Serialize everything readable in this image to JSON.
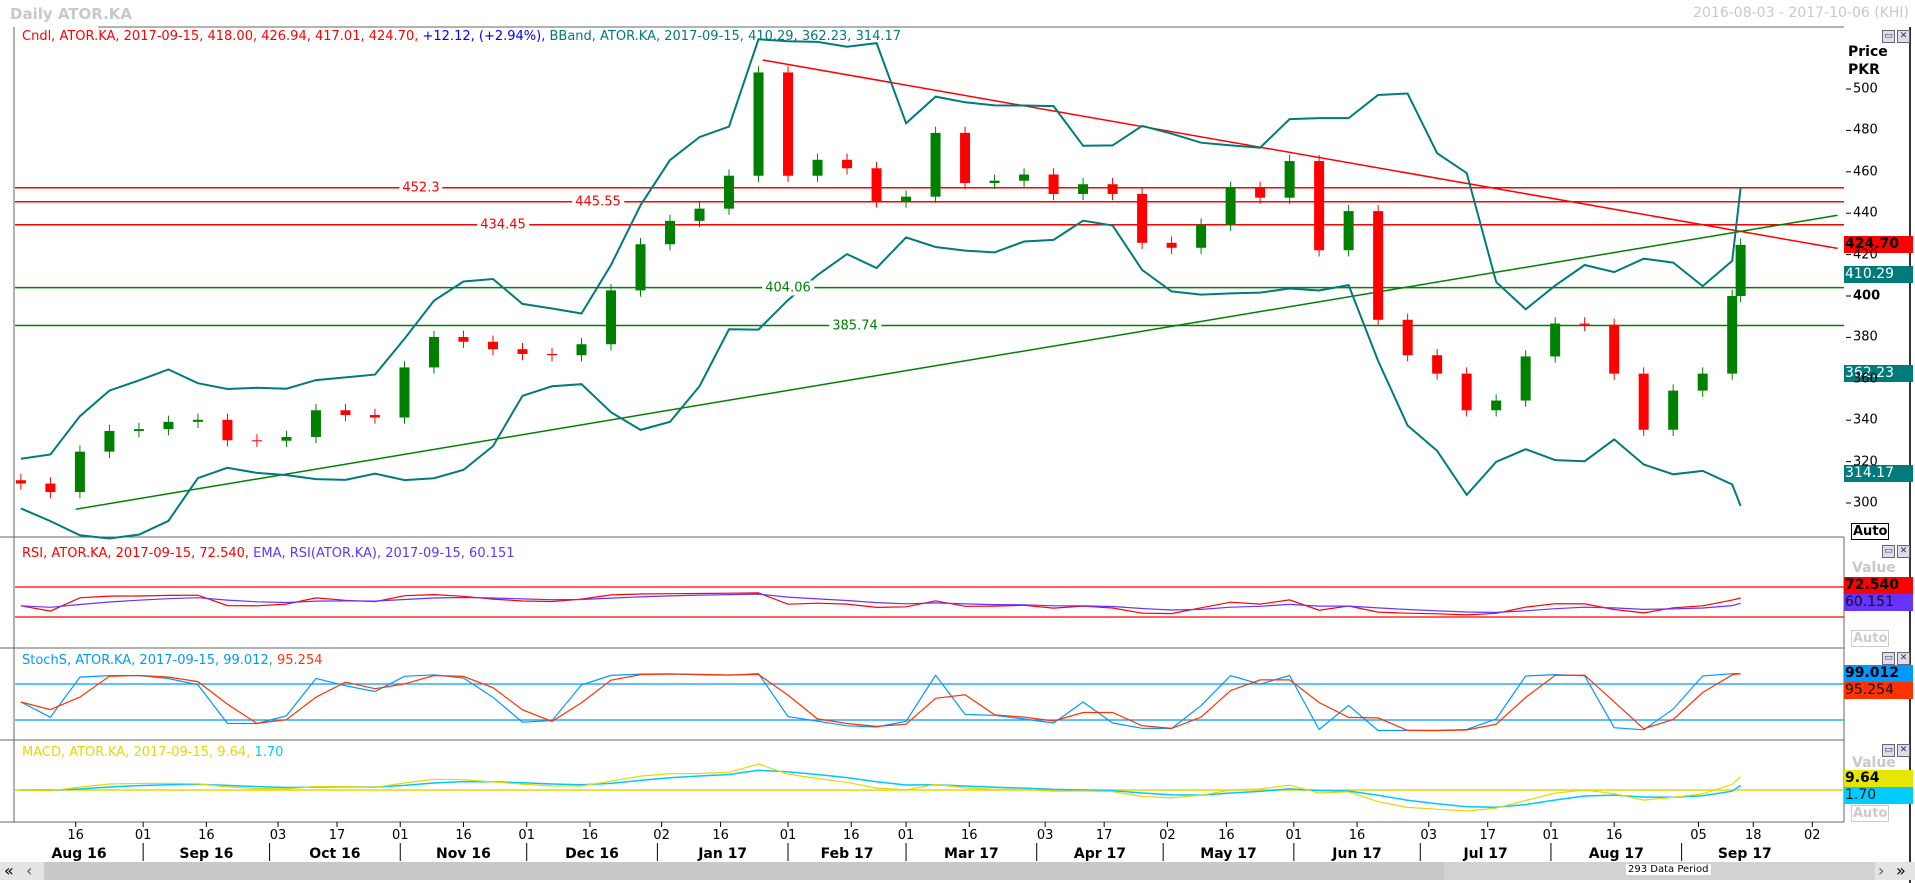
{
  "window": {
    "title": "Daily ATOR.KA",
    "date_range": "2016-08-03 - 2017-10-06 (KHI)"
  },
  "price_panel": {
    "legend_candle": "Cndl, ATOR.KA, 2017-09-15, 418.00, 426.94, 417.01, 424.70,",
    "legend_change": "+12.12, (+2.94%),",
    "legend_bband": "BBand, ATOR.KA, 2017-09-15, 410.29, 362.23, 314.17",
    "axis_title": "Price",
    "axis_unit": "PKR",
    "auto_label": "Auto",
    "last_close": "424.70",
    "bb_upper": "410.29",
    "bb_mid": "362.23",
    "bb_lower": "314.17"
  },
  "rsi_panel": {
    "legend_rsi": "RSI, ATOR.KA, 2017-09-15, 72.540,",
    "legend_ema": "EMA, RSI(ATOR.KA), 2017-09-15, 60.151",
    "value_label": "Value",
    "rsi_value": "72.540",
    "ema_value": "60.151",
    "auto_label": "Auto"
  },
  "stoch_panel": {
    "legend_k": "StochS, ATOR.KA, 2017-09-15, 99.012,",
    "legend_d": "95.254",
    "k_value": "99.012",
    "d_value": "95.254"
  },
  "macd_panel": {
    "legend_macd": "MACD, ATOR.KA, 2017-09-15, 9.64,",
    "legend_signal": "1.70",
    "value_label": "Value",
    "macd_value": "9.64",
    "signal_value": "1.70",
    "auto_label": "Auto"
  },
  "scrollbar": {
    "first": "«",
    "prev": "‹",
    "next": "›",
    "last": "»",
    "period_label": "293 Data Period"
  },
  "colors": {
    "up": "#008000",
    "down": "#ff0000",
    "bband": "#007b7b",
    "rsi": "#ff0000",
    "rsi_ema": "#6633ff",
    "stoch_k": "#0099ff",
    "stoch_d": "#ff3300",
    "macd": "#e6d800",
    "macd_signal": "#00c8ff",
    "resistance": "#ff0000",
    "support": "#008000"
  },
  "chart_data": {
    "type": "candlestick",
    "symbol": "ATOR.KA",
    "ylabel": "Price PKR",
    "ylim": [
      296,
      522
    ],
    "y_ticks": [
      500,
      480,
      460,
      440,
      420,
      400,
      380,
      360,
      340,
      320,
      300
    ],
    "dates": [
      "2016-08-03",
      "2016-08-10",
      "2016-08-17",
      "2016-08-24",
      "2016-08-31",
      "2016-09-07",
      "2016-09-14",
      "2016-09-21",
      "2016-09-28",
      "2016-10-05",
      "2016-10-12",
      "2016-10-19",
      "2016-10-26",
      "2016-11-02",
      "2016-11-09",
      "2016-11-16",
      "2016-11-23",
      "2016-11-30",
      "2016-12-07",
      "2016-12-14",
      "2016-12-21",
      "2016-12-28",
      "2017-01-04",
      "2017-01-11",
      "2017-01-18",
      "2017-01-25",
      "2017-02-01",
      "2017-02-08",
      "2017-02-15",
      "2017-02-22",
      "2017-03-01",
      "2017-03-08",
      "2017-03-15",
      "2017-03-22",
      "2017-03-29",
      "2017-04-05",
      "2017-04-12",
      "2017-04-19",
      "2017-04-26",
      "2017-05-03",
      "2017-05-10",
      "2017-05-17",
      "2017-05-24",
      "2017-05-31",
      "2017-06-07",
      "2017-06-14",
      "2017-06-21",
      "2017-06-28",
      "2017-07-05",
      "2017-07-12",
      "2017-07-19",
      "2017-07-26",
      "2017-08-02",
      "2017-08-09",
      "2017-08-16",
      "2017-08-23",
      "2017-08-30",
      "2017-09-06",
      "2017-09-13",
      "2017-09-15"
    ],
    "close": [
      309.4,
      305.3,
      324.8,
      334.8,
      335.7,
      339.2,
      340.2,
      330.3,
      330.1,
      331.9,
      344.8,
      342.5,
      341.3,
      365.5,
      380.2,
      377.9,
      374.3,
      372.0,
      371.4,
      376.7,
      402.7,
      425.0,
      436.3,
      442.2,
      458.1,
      508.0,
      458.1,
      465.8,
      461.7,
      445.7,
      448.0,
      478.8,
      454.6,
      455.7,
      458.7,
      449.3,
      454.0,
      449.3,
      425.7,
      423.3,
      434.5,
      452.2,
      447.5,
      465.2,
      422.1,
      441.0,
      388.5,
      371.4,
      362.5,
      344.8,
      349.5,
      370.8,
      386.7,
      386.1,
      362.5,
      335.4,
      354.3,
      362.5,
      400.0,
      424.7
    ],
    "horizontal_levels": [
      {
        "value": 452.3,
        "label": "452.3",
        "kind": "resistance"
      },
      {
        "value": 445.55,
        "label": "445.55",
        "kind": "resistance"
      },
      {
        "value": 434.45,
        "label": "434.45",
        "kind": "resistance"
      },
      {
        "value": 404.06,
        "label": "404.06",
        "kind": "support"
      },
      {
        "value": 385.74,
        "label": "385.74",
        "kind": "support"
      }
    ],
    "trendlines": [
      {
        "kind": "resistance",
        "from": [
          "2017-01-26",
          514
        ],
        "to": [
          "2017-10-08",
          423
        ]
      },
      {
        "kind": "support",
        "from": [
          "2016-08-16",
          297
        ],
        "to": [
          "2017-10-08",
          439
        ]
      }
    ],
    "rsi_levels": [
      70,
      30
    ],
    "stoch_levels": [
      80,
      20
    ],
    "x_ticks": [
      {
        "date": "2016-08-16",
        "label": "16"
      },
      {
        "date": "2016-09-01",
        "label": "01"
      },
      {
        "date": "2016-09-16",
        "label": "16"
      },
      {
        "date": "2016-10-03",
        "label": "03"
      },
      {
        "date": "2016-10-17",
        "label": "17"
      },
      {
        "date": "2016-11-01",
        "label": "01"
      },
      {
        "date": "2016-11-16",
        "label": "16"
      },
      {
        "date": "2016-12-01",
        "label": "01"
      },
      {
        "date": "2016-12-16",
        "label": "16"
      },
      {
        "date": "2017-01-02",
        "label": "02"
      },
      {
        "date": "2017-01-16",
        "label": "16"
      },
      {
        "date": "2017-02-01",
        "label": "01"
      },
      {
        "date": "2017-02-16",
        "label": "16"
      },
      {
        "date": "2017-03-01",
        "label": "01"
      },
      {
        "date": "2017-03-16",
        "label": "16"
      },
      {
        "date": "2017-04-03",
        "label": "03"
      },
      {
        "date": "2017-04-17",
        "label": "17"
      },
      {
        "date": "2017-05-02",
        "label": "02"
      },
      {
        "date": "2017-05-16",
        "label": "16"
      },
      {
        "date": "2017-06-01",
        "label": "01"
      },
      {
        "date": "2017-06-16",
        "label": "16"
      },
      {
        "date": "2017-07-03",
        "label": "03"
      },
      {
        "date": "2017-07-17",
        "label": "17"
      },
      {
        "date": "2017-08-01",
        "label": "01"
      },
      {
        "date": "2017-08-16",
        "label": "16"
      },
      {
        "date": "2017-09-05",
        "label": "05"
      },
      {
        "date": "2017-09-18",
        "label": "18"
      },
      {
        "date": "2017-10-02",
        "label": "02"
      }
    ],
    "months": [
      {
        "start": "2016-08-01",
        "end": "2016-09-01",
        "label": "Aug 16"
      },
      {
        "start": "2016-09-01",
        "end": "2016-10-01",
        "label": "Sep 16"
      },
      {
        "start": "2016-10-01",
        "end": "2016-11-01",
        "label": "Oct 16"
      },
      {
        "start": "2016-11-01",
        "end": "2016-12-01",
        "label": "Nov 16"
      },
      {
        "start": "2016-12-01",
        "end": "2017-01-01",
        "label": "Dec 16"
      },
      {
        "start": "2017-01-01",
        "end": "2017-02-01",
        "label": "Jan 17"
      },
      {
        "start": "2017-02-01",
        "end": "2017-03-01",
        "label": "Feb 17"
      },
      {
        "start": "2017-03-01",
        "end": "2017-04-01",
        "label": "Mar 17"
      },
      {
        "start": "2017-04-01",
        "end": "2017-05-01",
        "label": "Apr 17"
      },
      {
        "start": "2017-05-01",
        "end": "2017-06-01",
        "label": "May 17"
      },
      {
        "start": "2017-06-01",
        "end": "2017-07-01",
        "label": "Jun 17"
      },
      {
        "start": "2017-07-01",
        "end": "2017-08-01",
        "label": "Jul 17"
      },
      {
        "start": "2017-08-01",
        "end": "2017-09-01",
        "label": "Aug 17"
      },
      {
        "start": "2017-09-01",
        "end": "2017-10-01",
        "label": "Sep 17"
      }
    ]
  }
}
